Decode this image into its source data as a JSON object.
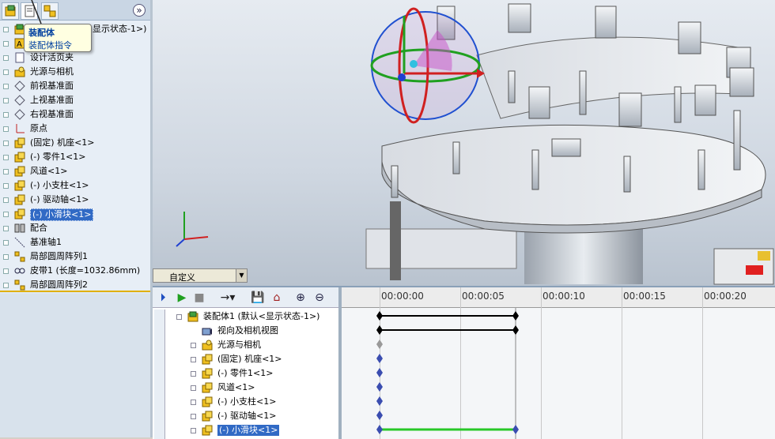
{
  "feature_tree": {
    "tabs": [
      "feature-manager",
      "property-manager",
      "configuration-manager"
    ],
    "expand_label": "»",
    "items": [
      {
        "label": "装配体1 (默认<显示状态-1>)",
        "icon": "assembly-icon"
      },
      {
        "label": "A",
        "icon": "annotations-icon"
      },
      {
        "label": "设计活页夹",
        "icon": "design-binder-icon"
      },
      {
        "label": "光源与相机",
        "icon": "lights-camera-icon"
      },
      {
        "label": "前视基准面",
        "icon": "plane-icon"
      },
      {
        "label": "上视基准面",
        "icon": "plane-icon"
      },
      {
        "label": "右视基准面",
        "icon": "plane-icon"
      },
      {
        "label": "原点",
        "icon": "origin-icon"
      },
      {
        "label": "(固定) 机座<1>",
        "icon": "part-icon"
      },
      {
        "label": "(-) 零件1<1>",
        "icon": "part-icon"
      },
      {
        "label": "风道<1>",
        "icon": "part-icon"
      },
      {
        "label": "(-) 小支柱<1>",
        "icon": "part-icon"
      },
      {
        "label": "(-) 驱动轴<1>",
        "icon": "part-icon"
      },
      {
        "label": "(-) 小滑块<1>",
        "icon": "part-icon",
        "selected": true
      },
      {
        "label": "配合",
        "icon": "mates-icon"
      },
      {
        "label": "基准轴1",
        "icon": "axis-icon"
      },
      {
        "label": "局部圆周阵列1",
        "icon": "pattern-icon"
      },
      {
        "label": "皮带1 (长度=1032.86mm)",
        "icon": "belt-icon"
      },
      {
        "label": "局部圆周阵列2",
        "icon": "pattern-icon"
      }
    ]
  },
  "tooltip": {
    "title": "装配体",
    "desc": "装配体指令"
  },
  "viewport": {
    "config_label": "自定义"
  },
  "motion_manager": {
    "toolbar": [
      "play-from-start",
      "play",
      "stop",
      "playback-mode",
      "save-animation",
      "animation-wizard",
      "zoom-in",
      "zoom-out"
    ],
    "tree": [
      {
        "label": "装配体1 (默认<显示状态-1>)",
        "icon": "assembly-icon",
        "level": 0
      },
      {
        "label": "视向及相机视图",
        "icon": "camera-view-icon",
        "level": 1
      },
      {
        "label": "光源与相机",
        "icon": "lights-camera-icon",
        "level": 1
      },
      {
        "label": "(固定) 机座<1>",
        "icon": "part-icon",
        "level": 1
      },
      {
        "label": "(-) 零件1<1>",
        "icon": "part-icon",
        "level": 1
      },
      {
        "label": "风道<1>",
        "icon": "part-icon",
        "level": 1
      },
      {
        "label": "(-) 小支柱<1>",
        "icon": "part-icon",
        "level": 1
      },
      {
        "label": "(-) 驱动轴<1>",
        "icon": "part-icon",
        "level": 1
      },
      {
        "label": "(-) 小滑块<1>",
        "icon": "part-icon",
        "level": 1,
        "selected": true
      }
    ],
    "time_labels": [
      "00:00:00",
      "00:00:05",
      "00:00:10",
      "00:00:15",
      "00:00:20"
    ]
  },
  "colors": {
    "selection": "#316ac5",
    "keyframe": "#3a4db0",
    "timebar_black": "#000000",
    "timebar_green": "#28c828"
  }
}
